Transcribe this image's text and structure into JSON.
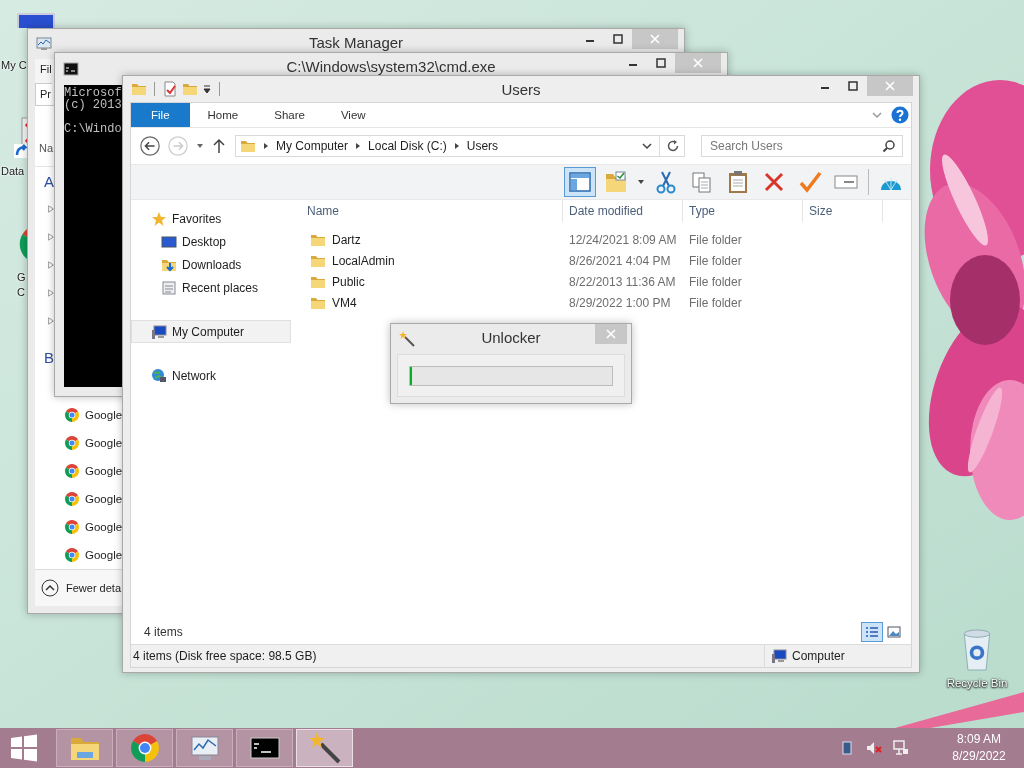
{
  "desktop_icons": [
    {
      "kind": "computer",
      "lines": [
        "My C"
      ]
    },
    {
      "kind": "document",
      "lines": [
        "Data"
      ]
    },
    {
      "kind": "browser",
      "lines": [
        "G",
        "C"
      ]
    }
  ],
  "recycle_bin": {
    "label": "Recycle Bin"
  },
  "task_manager": {
    "title": "Task Manager",
    "menu": "Fil",
    "tab": "Pr",
    "column": "Na",
    "groups": [
      "A",
      "B"
    ],
    "expanders": [
      {
        "expanded": false
      },
      {
        "expanded": false
      },
      {
        "expanded": false
      },
      {
        "expanded": false
      },
      {
        "expanded": false
      }
    ],
    "apps": [
      "Google",
      "Google",
      "Google",
      "Google",
      "Google",
      "Google"
    ],
    "footer": "Fewer deta"
  },
  "console": {
    "title": "C:\\Windows\\system32\\cmd.exe",
    "blocks": [
      [
        "Microsof",
        "(c) 2013"
      ],
      [
        "C:\\Windo"
      ]
    ]
  },
  "explorer": {
    "title": "Users",
    "ribbon_tabs": [
      {
        "label": "File",
        "selected": true
      },
      {
        "label": "Home",
        "selected": false
      },
      {
        "label": "Share",
        "selected": false
      },
      {
        "label": "View",
        "selected": false
      }
    ],
    "address": [
      "My Computer",
      "Local Disk (C:)",
      "Users"
    ],
    "search": {
      "placeholder": "Search Users"
    },
    "toolbar": [
      {
        "kind": "pane",
        "selected": true
      },
      {
        "kind": "folder-check",
        "selected": false
      },
      {
        "kind": "cut",
        "selected": false
      },
      {
        "kind": "copy",
        "selected": false
      },
      {
        "kind": "paste",
        "selected": false
      },
      {
        "kind": "delete",
        "selected": false
      },
      {
        "kind": "check",
        "selected": false
      },
      {
        "kind": "rename",
        "selected": false
      },
      {
        "kind": "shell",
        "selected": false
      }
    ],
    "nav": [
      {
        "label": "Favorites",
        "kind": "star",
        "selected": false,
        "children": [
          {
            "label": "Desktop",
            "kind": "desktop",
            "selected": false
          },
          {
            "label": "Downloads",
            "kind": "downloads",
            "selected": false
          },
          {
            "label": "Recent places",
            "kind": "recent",
            "selected": false
          }
        ]
      },
      {
        "label": "My Computer",
        "kind": "computer",
        "selected": true
      },
      {
        "label": "Network",
        "kind": "network",
        "selected": false
      }
    ],
    "columns": [
      "Name",
      "Date modified",
      "Type",
      "Size"
    ],
    "rows": [
      {
        "name": "Dartz",
        "date": "12/24/2021 8:09 AM",
        "type": "File folder"
      },
      {
        "name": "LocalAdmin",
        "date": "8/26/2021 4:04 PM",
        "type": "File folder"
      },
      {
        "name": "Public",
        "date": "8/22/2013 11:36 AM",
        "type": "File folder"
      },
      {
        "name": "VM4",
        "date": "8/29/2022 1:00 PM",
        "type": "File folder"
      }
    ],
    "item_count": "4 items",
    "views": [
      {
        "kind": "details",
        "selected": true
      },
      {
        "kind": "tiles",
        "selected": false
      }
    ],
    "status": {
      "text": "4 items (Disk free space: 98.5 GB)",
      "location": "Computer"
    }
  },
  "unlocker": {
    "title": "Unlocker",
    "level": 0.01
  },
  "taskbar": {
    "buttons": [
      {
        "kind": "explorer",
        "selected": false
      },
      {
        "kind": "browser",
        "selected": false
      },
      {
        "kind": "monitor",
        "selected": false
      },
      {
        "kind": "console",
        "selected": false
      },
      {
        "kind": "wand",
        "selected": true
      }
    ],
    "tray": {
      "muted": true
    },
    "clock": {
      "time": "8:09 AM",
      "date": "8/29/2022"
    }
  }
}
